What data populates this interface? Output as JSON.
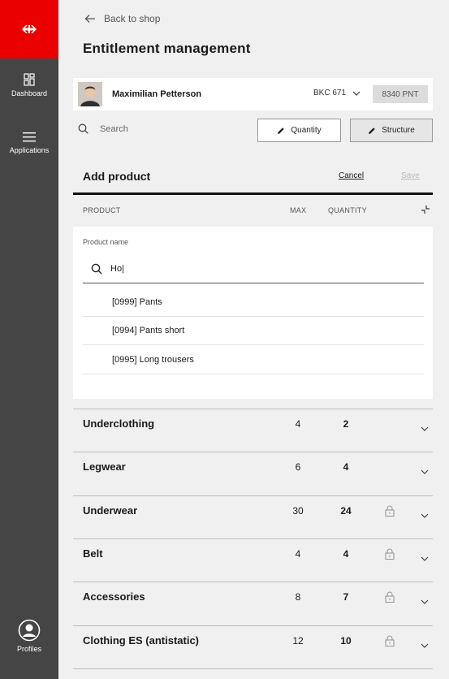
{
  "sidebar": {
    "logo": "sbb-logo",
    "items": [
      {
        "label": "Dashboard",
        "icon": "dashboard-icon"
      },
      {
        "label": "Applications",
        "icon": "menu-icon"
      }
    ],
    "profile": {
      "label": "Profiles",
      "icon": "user-circle-icon"
    }
  },
  "header": {
    "back_label": "Back to shop",
    "title": "Entitlement management"
  },
  "user": {
    "name": "Maximilian Petterson",
    "cost_center": "BKC 671",
    "points": "8340 PNT"
  },
  "toolbar": {
    "search_placeholder": "Search",
    "quantity_label": "Quantity",
    "structure_label": "Structure"
  },
  "panel": {
    "title": "Add product",
    "cancel_label": "Cancel",
    "save_label": "Save"
  },
  "columns": {
    "product": "PRODUCT",
    "max": "MAX",
    "quantity": "QUANTITY"
  },
  "product_search": {
    "label": "Product name",
    "value": "Ho|",
    "suggestions": [
      "[0999] Pants",
      "[0994] Pants short",
      "[0995] Long trousers"
    ]
  },
  "categories": [
    {
      "name": "Underclothing",
      "max": "4",
      "quantity": "2",
      "locked": false
    },
    {
      "name": "Legwear",
      "max": "6",
      "quantity": "4",
      "locked": false
    },
    {
      "name": "Underwear",
      "max": "30",
      "quantity": "24",
      "locked": true
    },
    {
      "name": "Belt",
      "max": "4",
      "quantity": "4",
      "locked": true
    },
    {
      "name": "Accessories",
      "max": "8",
      "quantity": "7",
      "locked": true
    },
    {
      "name": "Clothing ES (antistatic)",
      "max": "12",
      "quantity": "10",
      "locked": true
    }
  ],
  "colors": {
    "brand_red": "#eb0000",
    "sidebar": "#454545",
    "background": "#f0f0f0"
  }
}
